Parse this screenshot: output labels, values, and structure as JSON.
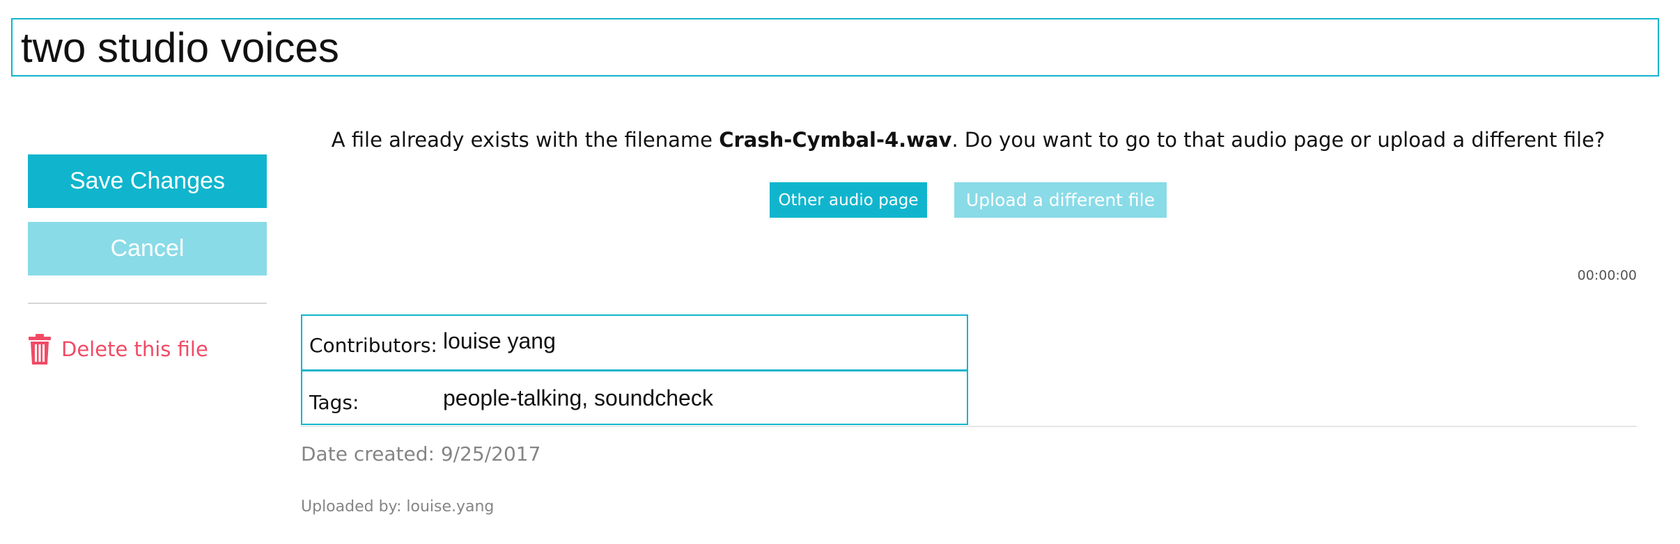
{
  "title": {
    "value": "two studio voices"
  },
  "sidebar": {
    "save_label": "Save Changes",
    "cancel_label": "Cancel",
    "delete_label": "Delete this file",
    "delete_icon": "trash-icon",
    "colors": {
      "primary": "#10b5cd",
      "primary_light": "#89dbe7",
      "danger": "#f04b66"
    }
  },
  "notice": {
    "prefix": "A file already exists with the filename ",
    "filename": "Crash-Cymbal-4.wav",
    "suffix": ". Do you want to go to that audio page or upload a different file?",
    "other_audio_label": "Other audio page",
    "upload_label": "Upload a different file"
  },
  "player": {
    "time": "00:00:00"
  },
  "metadata": {
    "contributors_label": "Contributors:",
    "contributors_value": "louise yang",
    "tags_label": "Tags:",
    "tags_value": "people-talking, soundcheck"
  },
  "footer": {
    "date_created": "Date created: 9/25/2017",
    "uploaded_by": "Uploaded by: louise.yang"
  }
}
